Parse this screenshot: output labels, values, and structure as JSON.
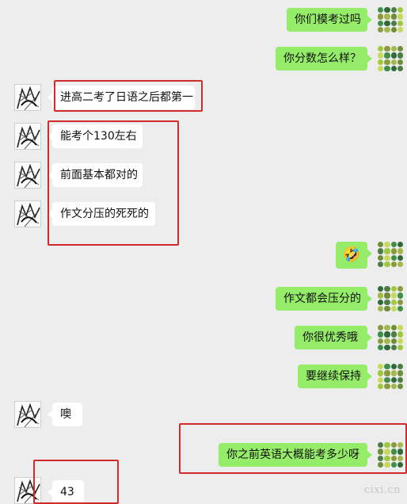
{
  "messages": [
    {
      "side": "out",
      "text": "你们模考过吗"
    },
    {
      "side": "out",
      "text": "你分数怎么样？"
    },
    {
      "side": "in",
      "text": "进高二考了日语之后都第一"
    },
    {
      "side": "in",
      "text": "能考个130左右"
    },
    {
      "side": "in",
      "text": "前面基本都对的"
    },
    {
      "side": "in",
      "text": "作文分压的死死的"
    },
    {
      "side": "out",
      "text": "🤣",
      "emoji_name": "laughing-tears-emoji"
    },
    {
      "side": "out",
      "text": "作文都会压分的"
    },
    {
      "side": "out",
      "text": "你很优秀哦"
    },
    {
      "side": "out",
      "text": "要继续保持"
    },
    {
      "side": "in",
      "text": "噢"
    },
    {
      "side": "out",
      "text": "你之前英语大概能考多少呀"
    },
    {
      "side": "in",
      "text": "43"
    }
  ],
  "avatar_colors": [
    "#3f8f4a",
    "#9fc93c",
    "#6d8f3a",
    "#2f6b3a",
    "#8a9a3c",
    "#c8d85a",
    "#4c7d44",
    "#a3b84a"
  ],
  "highlight_color": "#d12a2a",
  "watermark": "cixi.cn"
}
